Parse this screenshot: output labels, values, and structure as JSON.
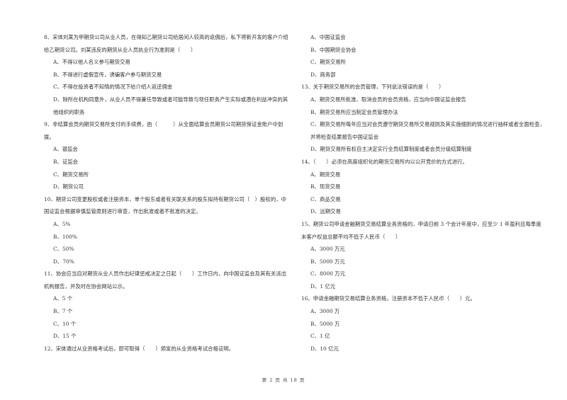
{
  "left_column": [
    {
      "stem": "8、宋体刘某为甲期货公司从业人员，在得知乙期货公司给居间人较高的返佣后，私下将新开发的客户介绍给乙期货公司。刘某违反的期货从业人员执业行为准则是（　　）",
      "options": [
        "A、不得以他人名义参与期货交易",
        "B、不得进行虚假宣传，诱骗客户参与期货交易",
        "C、不得在投资者不知情的情况下给介绍人返还佣金",
        "D、除所在机构同意外，从业人员不得兼任导致或者可能导致与现任职务产生实际或潜在利益冲突的其他组织的职务"
      ]
    },
    {
      "stem": "9、非结算会员向期货交易所支付的手续费，由（　　　）从全面结算会员期货公司期货保证金账户中划拨。",
      "options": [
        "A、银监会",
        "B、证监会",
        "C、期货交易所",
        "D、期货公司"
      ]
    },
    {
      "stem": "10、期货公司变更股权或者注册资本，单个股东或者有关联关系的股东拟持有期货公司（　）股权的，中国证监会根据审慎监管原则进行审查，作出批准或者不批准的决定。",
      "options": [
        "A、5%",
        "B、100%",
        "C、50%",
        "D、70%"
      ]
    },
    {
      "stem": "11、协会应当自对期货从业人员作出纪律惩戒决定之日起（　　）工作日内，向中国证监会及其有关派出机构报告，并及时在协会网站公示。",
      "options": [
        "A、5 个",
        "B、7 个",
        "C、10 个",
        "D、15 个"
      ]
    },
    {
      "stem": "12、宋体通过从业资格考试后，即可取得（　　）颁发的从业资格考试合格证明。",
      "options": []
    }
  ],
  "right_column": [
    {
      "stem": "",
      "options": [
        "A、中国证监会",
        "B、中国期货业协会",
        "C、期货交易所",
        "D、商务部"
      ]
    },
    {
      "stem": "13、关于期货交易所的会员管理，下列说法错误的是（　　）",
      "options": [
        "A、期货交易所批准、取消会员的会员资格，应当向中国证监会报告",
        "B、期货交易所应当制定会员管理办法",
        "C、期货交易所每年应当对会员遵守期货交易所交易规则及其实施细则的情况进行抽样或者全面检查，并将检查结果报告中国证监会",
        "D、期货交易所有权自主决定实行全员结算制度或者会员分级结算制度"
      ]
    },
    {
      "stem": "14、（　　）必须在高度组织化的期货交易所内以公开竞价的方式进行。",
      "options": [
        "A、期货交易",
        "B、现货交易",
        "C、商品交易",
        "D、远期交易"
      ]
    },
    {
      "stem": "15、期货公司申请金融期货交易结算业务资格的，申请日前 3 个会计年度中，应至少 1 年盈利且每季度末客户权益总额平均不低于人民币（　　）",
      "options": [
        "A、3000 万元",
        "B、5000 万元",
        "C、8000 万元",
        "D、1 亿元"
      ]
    },
    {
      "stem": "16、申请金融期货交易结算业务资格，注册资本不低于人民币（　　）元。",
      "options": [
        "A、3000 万",
        "B、5000 万",
        "C、1 亿",
        "D、10 亿元"
      ]
    }
  ],
  "footer": "第 2 页 共 18 页"
}
